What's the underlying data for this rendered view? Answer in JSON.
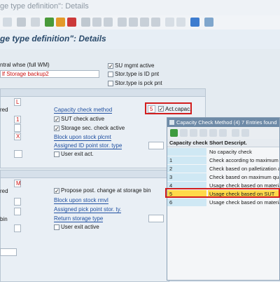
{
  "window": {
    "title": "ge type definition\": Details"
  },
  "page": {
    "title": "ge type definition\": Details"
  },
  "top": {
    "central_whse": "ntral whse (full WM)",
    "storage_type_desc": "lf Storage backup2",
    "su_mgmt": "SU mgmt active",
    "id_pnt": "Stor.type is ID pnt",
    "pck_pnt": "Stor.type is pck pnt"
  },
  "putaway": {
    "left_label": "red",
    "f1": "L",
    "f2": "1",
    "f3": "X",
    "capacity_check_label": "Capacity check method",
    "capacity_value": "5",
    "act_capac": "Act.capac.",
    "sut_check": "SUT check active",
    "storage_sec": "Storage sec. check active",
    "block_upon": "Block upon stock plcmt",
    "assigned_id": "Assigned ID point stor. type",
    "user_exit": "User exit act."
  },
  "removal": {
    "left_label": "red",
    "f1": "M",
    "bin_label": "bin",
    "propose": "Propose post. change at storage bin",
    "block_upon": "Block upon stock rmvl",
    "assigned_pick": "Assigned pick point stor. ty.",
    "return_type": "Return storage type",
    "user_exit": "User exit active"
  },
  "popup": {
    "title": "Capacity Check Method (4)   7 Entries found",
    "col1": "Capacity check",
    "col2": "Short Descript.",
    "rows": [
      {
        "code": "",
        "desc": "No capacity check"
      },
      {
        "code": "1",
        "desc": "Check according to maximum we"
      },
      {
        "code": "2",
        "desc": "Check based on palletization acc"
      },
      {
        "code": "3",
        "desc": "Check based on maximum quant"
      },
      {
        "code": "4",
        "desc": "Usage check based on material"
      },
      {
        "code": "5",
        "desc": "Usage check based on SUT"
      },
      {
        "code": "6",
        "desc": "Usage check based on material p"
      }
    ]
  },
  "colors": {
    "highlight": "#ffd94a",
    "accent": "#d21e1e",
    "link": "#1f4fa0"
  }
}
